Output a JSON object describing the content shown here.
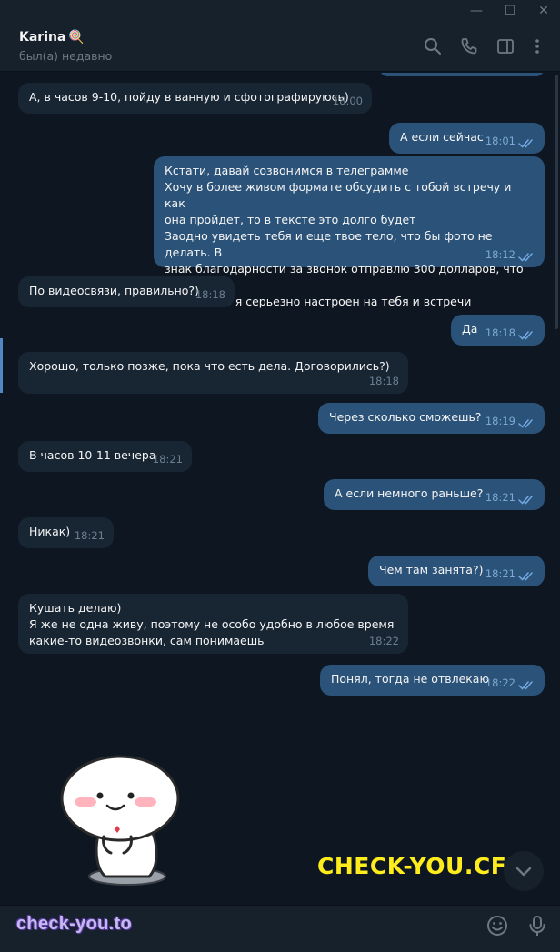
{
  "window": {
    "minimize": "—",
    "maximize": "☐",
    "close": "✕"
  },
  "header": {
    "name": "Karina",
    "name_emoji": "🍭",
    "status": "был(а) недавно",
    "icons": [
      "search-icon",
      "phone-icon",
      "sidebar-icon",
      "more-icon"
    ]
  },
  "messages": [
    {
      "dir": "in",
      "text": "А, в часов 9-10, пойду в ванную и сфотографируюсь)",
      "time": "18:00"
    },
    {
      "dir": "out",
      "text": "А если сейчас",
      "time": "18:01"
    },
    {
      "dir": "out",
      "text": "Кстати, давай созвонимся в телеграмме\nХочу в более живом формате обсудить с тобой встречу и как\nона пройдет, то в тексте это долго будет\nЗаодно увидеть тебя и еще твое тело, что бы фото не делать. В\nзнак благодарности за звонок отправлю 300 долларов, что бы ты\nвидела что я серьезно настроен на тебя и встречи",
      "time": "18:12"
    },
    {
      "dir": "in",
      "text": "По видеосвязи, правильно?)",
      "time": "18:18"
    },
    {
      "dir": "out",
      "text": "Да",
      "time": "18:18"
    },
    {
      "dir": "in",
      "text": "Хорошо, только позже, пока что есть дела. Договорились?)",
      "time": "18:18"
    },
    {
      "dir": "out",
      "text": "Через сколько сможешь?",
      "time": "18:19"
    },
    {
      "dir": "in",
      "text": "В часов 10-11 вечера",
      "time": "18:21"
    },
    {
      "dir": "out",
      "text": "А если немного раньше?",
      "time": "18:21"
    },
    {
      "dir": "in",
      "text": "Никак)",
      "time": "18:21"
    },
    {
      "dir": "out",
      "text": "Чем там занята?)",
      "time": "18:21"
    },
    {
      "dir": "in",
      "text": "Кушать делаю)\nЯ же не одна живу, поэтому не особо удобно в любое время\nкакие-то видеозвонки, сам понимаешь",
      "time": "18:22"
    },
    {
      "dir": "out",
      "text": "Понял, тогда не отвлекаю",
      "time": "18:22"
    }
  ],
  "watermarks": {
    "main": "CHECK-YOU.CFD",
    "composer": "check-you.to"
  },
  "composer": {
    "placeholder": "",
    "icons": [
      "emoji-icon",
      "microphone-icon"
    ]
  },
  "colors": {
    "background": "#0e1621",
    "panel": "#17212b",
    "incoming_bubble": "#182533",
    "outgoing_bubble": "#2b5278",
    "accent": "#5288c1",
    "watermark_yellow": "#ffec1c"
  }
}
